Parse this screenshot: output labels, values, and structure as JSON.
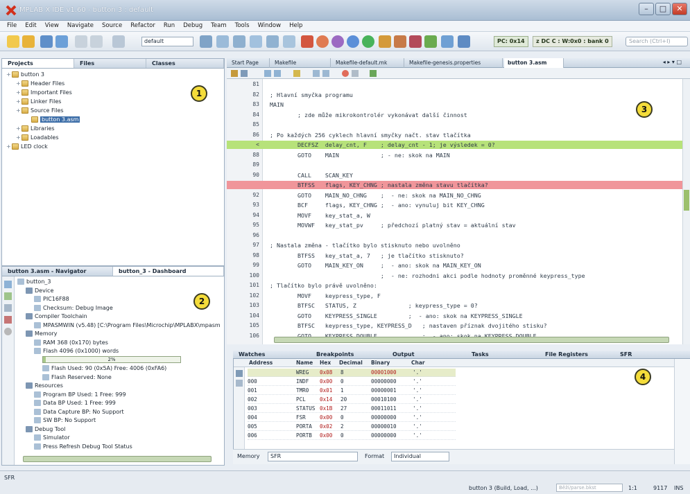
{
  "window": {
    "title": "MPLAB X IDE v1.60 - button 3 : default"
  },
  "menu": [
    "File",
    "Edit",
    "View",
    "Navigate",
    "Source",
    "Refactor",
    "Run",
    "Debug",
    "Team",
    "Tools",
    "Window",
    "Help"
  ],
  "toolbar": {
    "config": "default",
    "pc": "PC: 0x14",
    "status_regs": "z DC C : W:0x0 : bank 0",
    "search_placeholder": "Search (Ctrl+I)"
  },
  "projects_panel": {
    "tabs": [
      "Projects",
      "Files",
      "Classes"
    ],
    "tree": [
      {
        "label": "button 3",
        "depth": 0
      },
      {
        "label": "Header Files",
        "depth": 1
      },
      {
        "label": "Important Files",
        "depth": 1
      },
      {
        "label": "Linker Files",
        "depth": 1
      },
      {
        "label": "Source Files",
        "depth": 1
      },
      {
        "label": "button 3.asm",
        "depth": 2
      },
      {
        "label": "Libraries",
        "depth": 1
      },
      {
        "label": "Loadables",
        "depth": 1
      },
      {
        "label": "LED clock",
        "depth": 0
      }
    ]
  },
  "dashboard": {
    "tabs": [
      "button 3.asm - Navigator",
      "button_3 - Dashboard"
    ],
    "tree": [
      {
        "label": "button_3",
        "depth": 0
      },
      {
        "label": "Device",
        "depth": 1
      },
      {
        "label": "PIC16F88",
        "depth": 2
      },
      {
        "label": "Checksum: Debug Image",
        "depth": 2
      },
      {
        "label": "Compiler Toolchain",
        "depth": 1
      },
      {
        "label": "MPASMWIN (v5.48) [C:\\Program Files\\Microchip\\MPLABX\\mpasm",
        "depth": 2
      },
      {
        "label": "Memory",
        "depth": 1
      },
      {
        "label": "RAM 368 (0x170) bytes",
        "depth": 2
      },
      {
        "label": "Flash 4096 (0x1000) words",
        "depth": 2
      },
      {
        "label": "2%",
        "depth": 3
      },
      {
        "label": "Flash Used: 90 (0x5A) Free: 4006 (0xFA6)",
        "depth": 3
      },
      {
        "label": "Flash Reserved: None",
        "depth": 3
      },
      {
        "label": "Resources",
        "depth": 1
      },
      {
        "label": "Program BP Used: 1  Free: 999",
        "depth": 2
      },
      {
        "label": "Data BP Used: 1  Free: 999",
        "depth": 2
      },
      {
        "label": "Data Capture BP: No Support",
        "depth": 2
      },
      {
        "label": "SW BP: No Support",
        "depth": 2
      },
      {
        "label": "Debug Tool",
        "depth": 1
      },
      {
        "label": "Simulator",
        "depth": 2
      },
      {
        "label": "Press Refresh Debug Tool Status",
        "depth": 2
      }
    ],
    "flash_used_fraction": 0.02
  },
  "editor": {
    "tabs": [
      "Start Page",
      "Makefile",
      "Makefile-default.mk",
      "Makefile-genesis.properties",
      "button 3.asm"
    ],
    "lines": [
      {
        "n": "81",
        "t": ""
      },
      {
        "n": "82",
        "t": "; Hlavní smyčka programu"
      },
      {
        "n": "83",
        "t": "MAIN"
      },
      {
        "n": "84",
        "t": "        ; zde může mikrokontrolér vykonávat další činnost"
      },
      {
        "n": "85",
        "t": ""
      },
      {
        "n": "86",
        "t": "; Po každých 256 cyklech hlavní smyčky načt. stav tlačítka"
      },
      {
        "n": "<",
        "t": "        DECFSZ  delay_cnt, F    ; delay_cnt - 1; je výsledek = 0?",
        "hl": "green"
      },
      {
        "n": "88",
        "t": "        GOTO    MAIN            ; - ne: skok na MAIN"
      },
      {
        "n": "89",
        "t": ""
      },
      {
        "n": "90",
        "t": "        CALL    SCAN_KEY"
      },
      {
        "n": "",
        "t": "        BTFSS   flags, KEY_CHNG ; nastala změna stavu tlačítka?",
        "hl": "red"
      },
      {
        "n": "92",
        "t": "        GOTO    MAIN_NO_CHNG    ;  - ne: skok na MAIN_NO_CHNG"
      },
      {
        "n": "93",
        "t": "        BCF     flags, KEY_CHNG ;  - ano: vynuluj bit KEY_CHNG"
      },
      {
        "n": "94",
        "t": "        MOVF    key_stat_a, W"
      },
      {
        "n": "95",
        "t": "        MOVWF   key_stat_pv     ; předchozí platný stav = aktuální stav"
      },
      {
        "n": "96",
        "t": ""
      },
      {
        "n": "97",
        "t": "; Nastala změna - tlačítko bylo stisknuto nebo uvolněno"
      },
      {
        "n": "98",
        "t": "        BTFSS   key_stat_a, 7   ; je tlačítko stisknuto?"
      },
      {
        "n": "99",
        "t": "        GOTO    MAIN_KEY_ON     ;  - ano: skok na MAIN_KEY_ON"
      },
      {
        "n": "100",
        "t": "                                ;  - ne: rozhodni akci podle hodnoty proměnné keypress_type"
      },
      {
        "n": "101",
        "t": "; Tlačítko bylo právě uvolněno:"
      },
      {
        "n": "102",
        "t": "        MOVF    keypress_type, F"
      },
      {
        "n": "103",
        "t": "        BTFSC   STATUS, Z               ; keypress_type = 0?"
      },
      {
        "n": "104",
        "t": "        GOTO    KEYPRESS_SINGLE         ;  - ano: skok na KEYPRESS_SINGLE"
      },
      {
        "n": "105",
        "t": "        BTFSC   keypress_type, KEYPRESS_D   ; nastaven příznak dvojitého stisku?"
      },
      {
        "n": "106",
        "t": "        GOTO    KEYPRESS_DOUBLE             ;  - ano: skok na KEYPRESS_DOUBLE"
      }
    ]
  },
  "bottom": {
    "tabs": [
      "Watches",
      "Breakpoints",
      "Output",
      "Tasks",
      "File Registers",
      "SFR"
    ],
    "columns": [
      "Address",
      "Name",
      "Hex",
      "Decimal",
      "Binary",
      "Char"
    ],
    "rows": [
      [
        "",
        "WREG",
        "0x08",
        "8",
        "00001000",
        "'.'"
      ],
      [
        "000",
        "INDF",
        "0x00",
        "0",
        "00000000",
        "'.'"
      ],
      [
        "001",
        "TMR0",
        "0x01",
        "1",
        "00000001",
        "'.'"
      ],
      [
        "002",
        "PCL",
        "0x14",
        "20",
        "00010100",
        "'.'"
      ],
      [
        "003",
        "STATUS",
        "0x1B",
        "27",
        "00011011",
        "'.'"
      ],
      [
        "004",
        "FSR",
        "0x00",
        "0",
        "00000000",
        "'.'"
      ],
      [
        "005",
        "PORTA",
        "0x02",
        "2",
        "00000010",
        "'.'"
      ],
      [
        "006",
        "PORTB",
        "0x00",
        "0",
        "00000000",
        "'.'"
      ]
    ],
    "memory_label": "Memory",
    "memory_value": "SFR",
    "format_label": "Format",
    "format_value": "Individual"
  },
  "callouts": [
    "1",
    "2",
    "3",
    "4"
  ],
  "statusbar": {
    "left": "SFR",
    "build": "button 3 (Build, Load, ...)",
    "progress_text": "Běží/parse.bkst",
    "pos1": "1:1",
    "pos2": "9117",
    "mode": "INS"
  }
}
